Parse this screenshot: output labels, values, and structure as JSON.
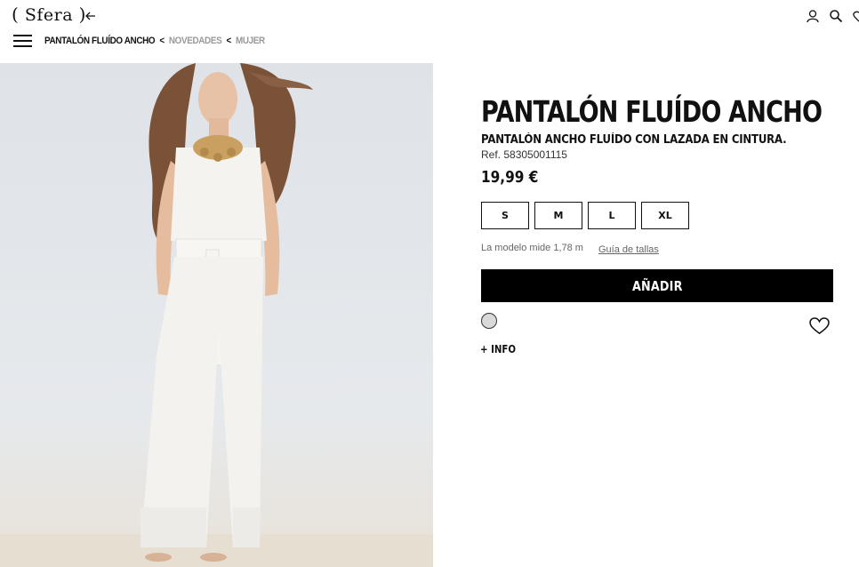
{
  "header": {
    "logo_text": "Sfera",
    "breadcrumb": {
      "current": "PANTALÓN FLUÍDO ANCHO",
      "separator": "<",
      "items": [
        "NOVEDADES",
        "MUJER"
      ]
    },
    "icons": [
      "back-arrow-icon",
      "account-icon",
      "search-icon",
      "wishlist-icon",
      "menu-icon"
    ]
  },
  "product": {
    "title": "PANTALÓN FLUÍDO ANCHO",
    "subtitle": "PANTALÓN ANCHO FLUÍDO CON LAZADA EN CINTURA.",
    "ref": "Ref. 58305001115",
    "price": "19,99 €",
    "sizes": [
      "S",
      "M",
      "L",
      "XL"
    ],
    "model_info": "La modelo mide 1,78 m",
    "size_guide": "Guía de tallas",
    "add_button": "AÑADIR",
    "color_swatch": "#d9d9d9",
    "more_info": "+ INFO"
  },
  "colors": {
    "accent": "#000000",
    "breadcrumb_link": "#999999"
  }
}
